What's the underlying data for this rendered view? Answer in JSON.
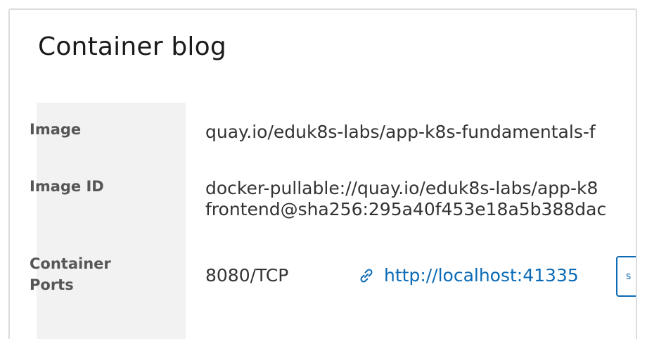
{
  "card": {
    "title": "Container blog"
  },
  "details": {
    "image_label": "Image",
    "image_value": "quay.io/eduk8s-labs/app-k8s-fundamentals-f",
    "image_id_label": "Image ID",
    "image_id_line1": "docker-pullable://quay.io/eduk8s-labs/app-k8",
    "image_id_line2": "frontend@sha256:295a40f453e18a5b388dac",
    "ports_label_line1": "Container",
    "ports_label_line2": "Ports",
    "port_value": "8080/TCP",
    "port_link": "http://localhost:41335",
    "port_link_icon": "link-icon",
    "side_button_label": "s"
  },
  "colors": {
    "link": "#0a6ab5",
    "label_bg": "#f2f2f2",
    "border": "#dcdcdc"
  }
}
